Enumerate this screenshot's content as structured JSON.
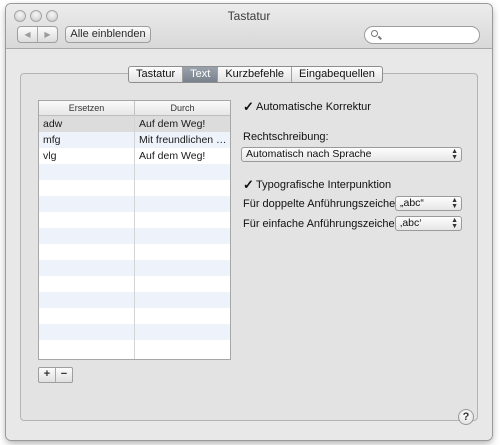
{
  "window": {
    "title": "Tastatur"
  },
  "toolbar": {
    "back_glyph": "◀",
    "forward_glyph": "▶",
    "show_all_label": "Alle einblenden",
    "search_placeholder": ""
  },
  "tabs": [
    {
      "label": "Tastatur",
      "active": false
    },
    {
      "label": "Text",
      "active": true
    },
    {
      "label": "Kurzbefehle",
      "active": false
    },
    {
      "label": "Eingabequellen",
      "active": false
    }
  ],
  "table": {
    "headers": [
      "Ersetzen",
      "Durch"
    ],
    "rows": [
      {
        "replace": "adw",
        "with": "Auf dem Weg!"
      },
      {
        "replace": "mfg",
        "with": "Mit freundlichen Grüßen"
      },
      {
        "replace": "vlg",
        "with": "Auf dem Weg!"
      }
    ]
  },
  "buttons": {
    "add": "+",
    "remove": "−",
    "help": "?"
  },
  "options": {
    "auto_correct_label": "Automatische Korrektur",
    "spelling_label": "Rechtschreibung:",
    "spelling_value": "Automatisch nach Sprache",
    "typo_label": "Typografische Interpunktion",
    "double_quotes_label": "Für doppelte Anführungszeichen",
    "double_quotes_value": "„abc“",
    "single_quotes_label": "Für einfache Anführungszeichen",
    "single_quotes_value": "‚abc‘",
    "check_glyph": "✓"
  },
  "colors": {
    "active_tab": "#7d8691",
    "row_alt": "#eef3fb",
    "selected_row": "#dcdcdc"
  }
}
